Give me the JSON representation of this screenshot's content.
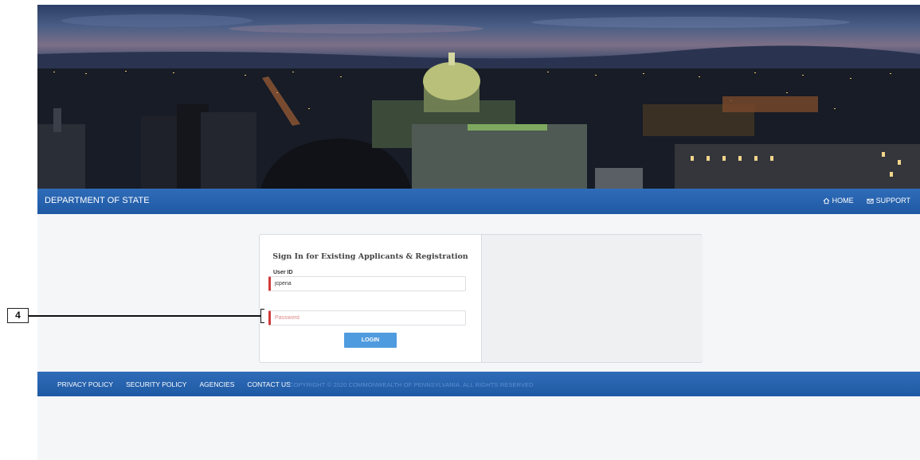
{
  "header": {
    "department": "DEPARTMENT OF STATE",
    "nav": [
      {
        "label": "HOME",
        "icon": "home-icon"
      },
      {
        "label": "SUPPORT",
        "icon": "mail-icon"
      }
    ]
  },
  "login": {
    "title": "Sign In for Existing Applicants & Registration",
    "user_id_label": "User ID",
    "user_id_value": "jcpena",
    "password_placeholder": "Password",
    "login_button": "LOGIN"
  },
  "footer": {
    "links": [
      "PRIVACY POLICY",
      "SECURITY POLICY",
      "AGENCIES",
      "CONTACT US"
    ],
    "copyright": "COPYRIGHT © 2020 COMMONWEALTH OF PENNSYLVANIA. ALL RIGHTS RESERVED"
  },
  "callout": {
    "number": "4"
  },
  "colors": {
    "header_blue": "#2a65b2",
    "button_blue": "#4f9bdf",
    "required_red": "#d23a3a"
  }
}
